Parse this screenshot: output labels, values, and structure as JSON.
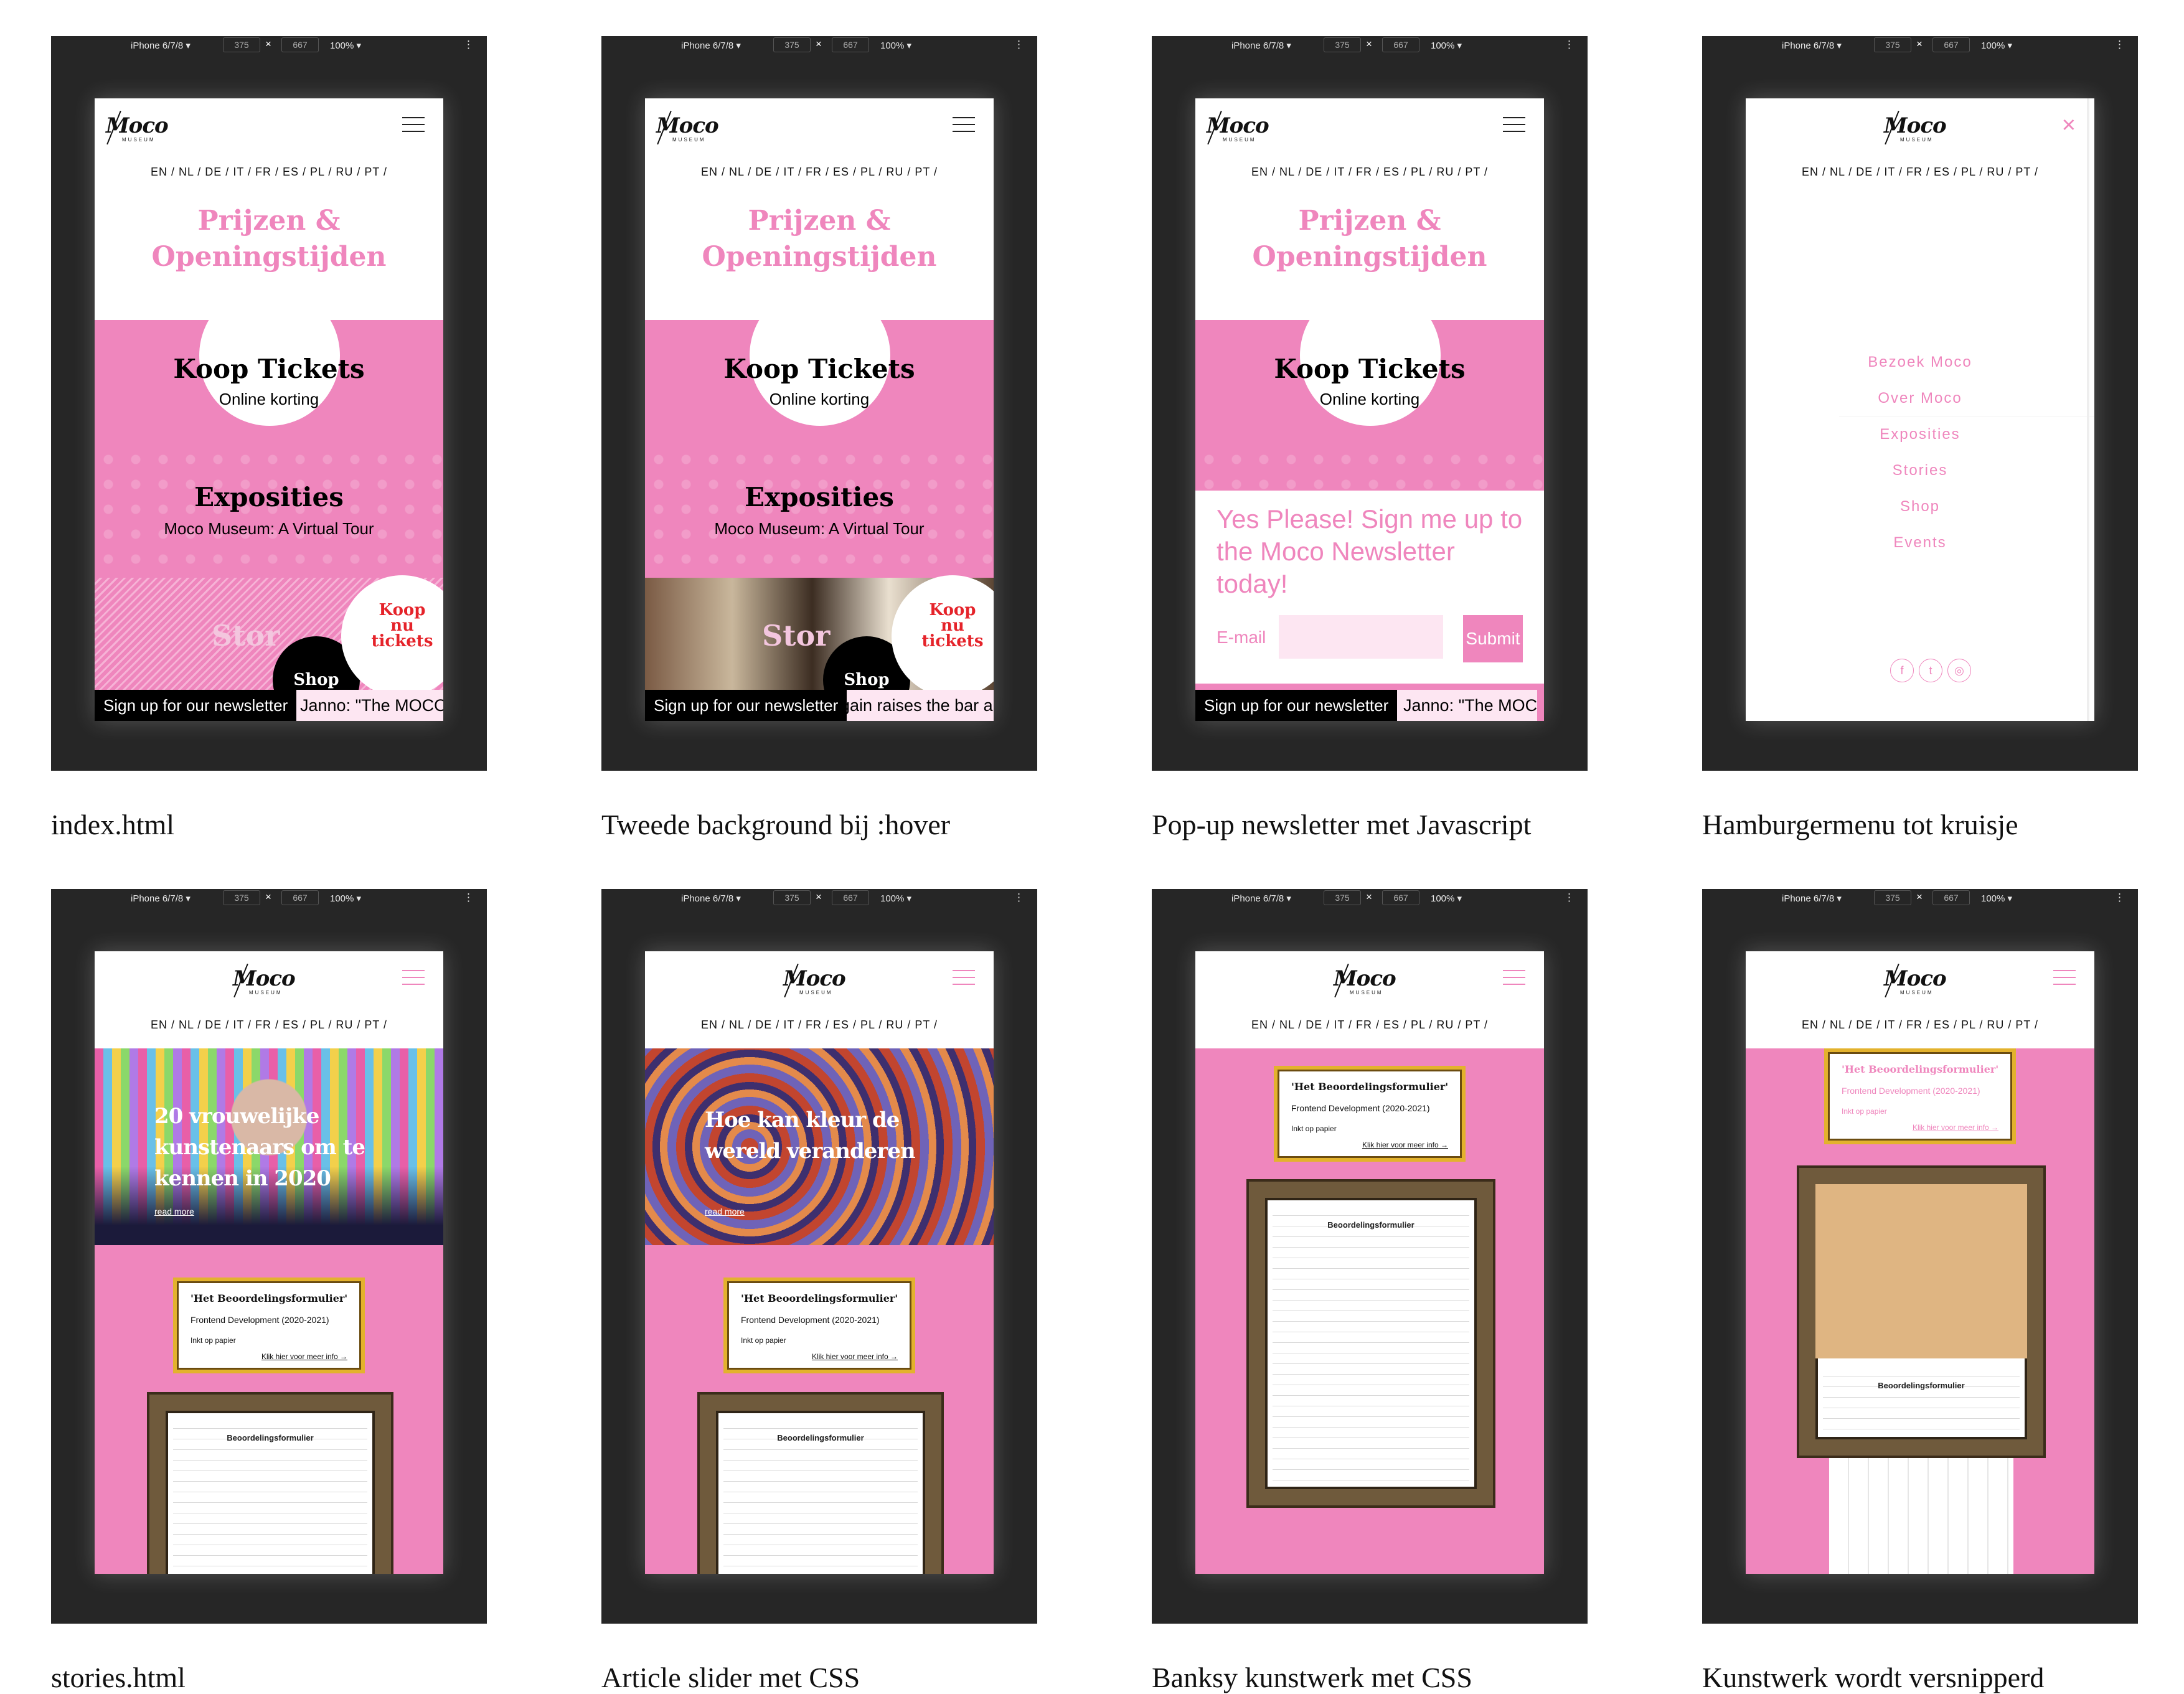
{
  "toolbar": {
    "device": "iPhone 6/7/8 ▾",
    "width": "375",
    "times": "×",
    "height": "667",
    "zoom": "100% ▾",
    "more": "⋮"
  },
  "site": {
    "logo": "Moco",
    "logo_sub": "MUSEUM",
    "languages": "EN / NL / DE / IT / FR / ES / PL / RU / PT /",
    "title_line1": "Prijzen &",
    "title_line2": "Openingstijden",
    "koop_title": "Koop Tickets",
    "koop_sub": "Online korting",
    "expo_title": "Exposities",
    "expo_sub": "Moco Museum: A Virtual Tour",
    "stories_word": "Stor",
    "shop": "Shop",
    "koop_nu_line1": "Koop",
    "koop_nu_line2": "nu",
    "koop_nu_line3": "tickets",
    "newsletter_bar": "Sign up for our newsletter",
    "ticker1": "Janno: \"The MOCO",
    "ticker2": "gain raises the bar ar",
    "ticker3": "Janno: \"The MOC"
  },
  "popup": {
    "headline": "Yes Please! Sign me up to the Moco Newsletter today!",
    "email_label": "E-mail",
    "submit": "Submit"
  },
  "menu": {
    "items": [
      "Bezoek Moco",
      "Over Moco",
      "Exposities",
      "Stories",
      "Shop",
      "Events"
    ],
    "social": [
      "f",
      "t",
      "◎"
    ]
  },
  "stories": {
    "hero1_title": "20 vrouwelijke kunstenaars om te kennen in 2020",
    "hero2_title": "Hoe kan kleur de wereld veranderen",
    "read_more": "read more",
    "card_title": "'Het Beoordelingsformulier'",
    "card_sub": "Frontend Development (2020-2021)",
    "card_sub2": "Inkt op papier",
    "card_link": "Klik hier voor meer info →",
    "doc_title": "Beoordelingsformulier"
  },
  "captions": [
    "index.html",
    "Tweede background bij :hover",
    "Pop-up newsletter met Javascript",
    "Hamburgermenu tot kruisje",
    "stories.html",
    "Article slider met CSS",
    "Banksy kunstwerk met CSS",
    "Kunstwerk wordt versnipperd"
  ],
  "colors": {
    "pink": "#ef86bd",
    "light_pink": "#fde6f2",
    "dark": "#262626",
    "gold": "#e3b22d",
    "red": "#e5232a"
  }
}
